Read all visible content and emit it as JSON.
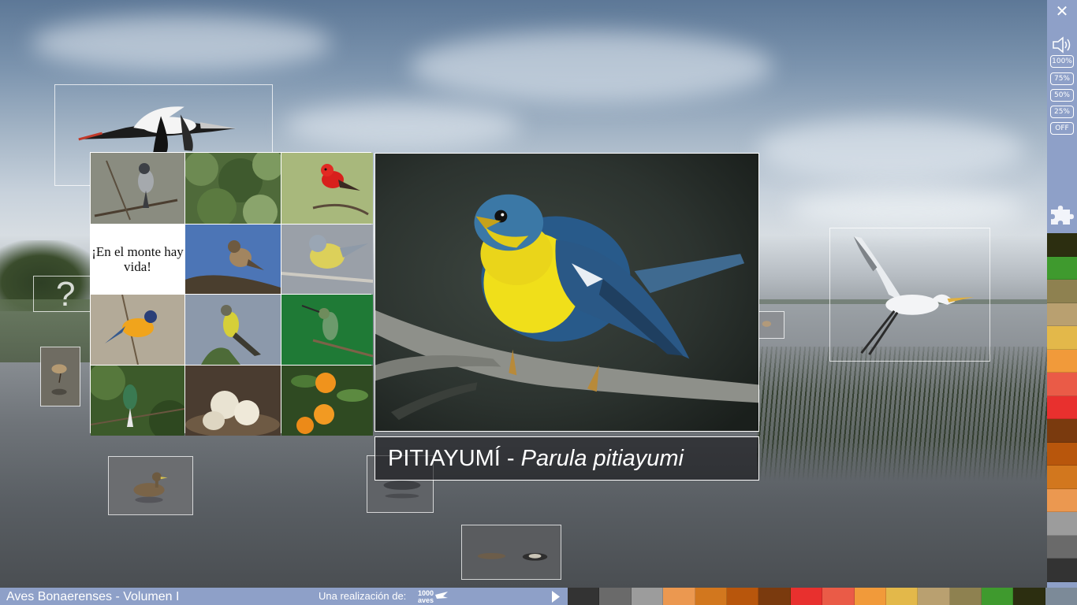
{
  "app": {
    "title": "Aves Bonaerenses - Volumen I",
    "credit_label": "Una realización de:",
    "logo_text": "1000 aves"
  },
  "main": {
    "caption_common": "PITIAYUMÍ - ",
    "caption_scientific": "Parula pitiayumi"
  },
  "grid": {
    "text_cell": "¡En el monte hay vida!"
  },
  "help": {
    "symbol": "?"
  },
  "toolbar": {
    "close_symbol": "✕",
    "volume_options": [
      "100%",
      "75%",
      "50%",
      "25%",
      "OFF"
    ],
    "icons": [
      "close-icon",
      "speaker-icon",
      "puzzle-icon"
    ]
  },
  "palette": {
    "side": [
      "#2c2e10",
      "#3f9a2e",
      "#8e8150",
      "#b9a070",
      "#e3b84a",
      "#f19a3a",
      "#ea5b47",
      "#e8302e",
      "#7a3a0e",
      "#b8560c",
      "#d2771e",
      "#eb9850",
      "#9c9c9c",
      "#6a6a6a",
      "#333333"
    ],
    "bottom": [
      "#333333",
      "#6a6a6a",
      "#9c9c9c",
      "#eb9850",
      "#d2771e",
      "#b8560c",
      "#7a3a0e",
      "#e8302e",
      "#ea5b47",
      "#f19a3a",
      "#e3b84a",
      "#b9a070",
      "#8e8150",
      "#3f9a2e",
      "#2c2e10"
    ]
  }
}
